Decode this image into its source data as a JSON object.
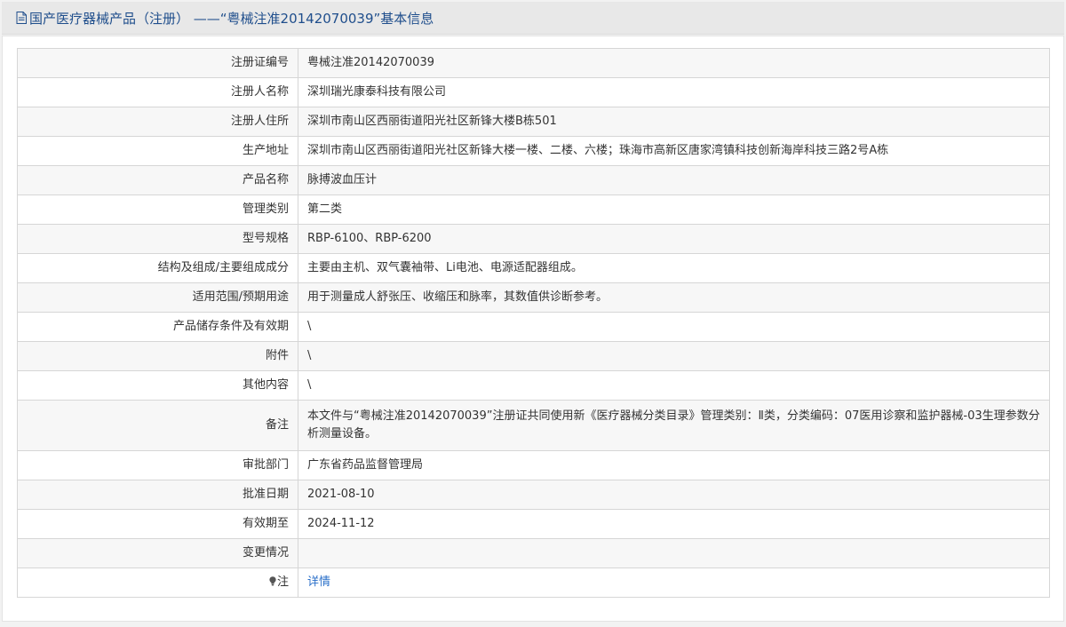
{
  "header": {
    "icon": "document-icon",
    "title": "国产医疗器械产品（注册） ——“粤械注准20142070039”基本信息"
  },
  "rows": [
    {
      "label": "注册证编号",
      "value": "粤械注准20142070039"
    },
    {
      "label": "注册人名称",
      "value": "深圳瑞光康泰科技有限公司"
    },
    {
      "label": "注册人住所",
      "value": "深圳市南山区西丽街道阳光社区新锋大楼B栋501"
    },
    {
      "label": "生产地址",
      "value": "深圳市南山区西丽街道阳光社区新锋大楼一楼、二楼、六楼；珠海市高新区唐家湾镇科技创新海岸科技三路2号A栋"
    },
    {
      "label": "产品名称",
      "value": "脉搏波血压计"
    },
    {
      "label": "管理类别",
      "value": "第二类"
    },
    {
      "label": "型号规格",
      "value": "RBP-6100、RBP-6200"
    },
    {
      "label": "结构及组成/主要组成成分",
      "value": "主要由主机、双气囊袖带、Li电池、电源适配器组成。"
    },
    {
      "label": "适用范围/预期用途",
      "value": "用于测量成人舒张压、收缩压和脉率，其数值供诊断参考。"
    },
    {
      "label": "产品储存条件及有效期",
      "value": "\\"
    },
    {
      "label": "附件",
      "value": "\\"
    },
    {
      "label": "其他内容",
      "value": "\\"
    },
    {
      "label": "备注",
      "value": "本文件与“粤械注准20142070039”注册证共同使用新《医疗器械分类目录》管理类别：Ⅱ类，分类编码：07医用诊察和监护器械-03生理参数分析测量设备。"
    },
    {
      "label": "审批部门",
      "value": "广东省药品监督管理局"
    },
    {
      "label": "批准日期",
      "value": "2021-08-10"
    },
    {
      "label": "有效期至",
      "value": "2024-11-12"
    },
    {
      "label": "变更情况",
      "value": ""
    }
  ],
  "note": {
    "icon": "lightbulb-icon",
    "label": "注",
    "link_text": "详情"
  },
  "colors": {
    "title": "#1f4e8c",
    "link": "#2a6fc9",
    "border": "#d6d6d6"
  }
}
